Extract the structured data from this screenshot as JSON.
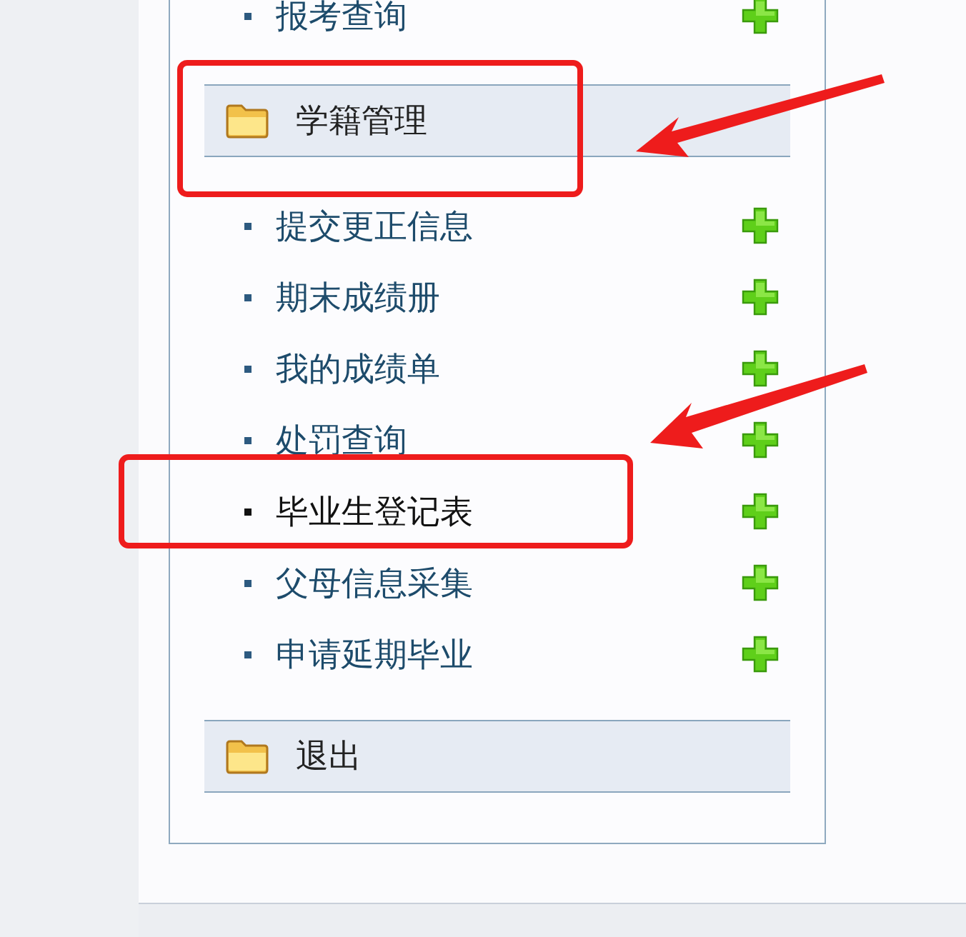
{
  "menu": [
    {
      "kind": "item",
      "label": "报考查询",
      "selected": false
    },
    {
      "kind": "header",
      "label": "学籍管理"
    },
    {
      "kind": "item",
      "label": "提交更正信息",
      "selected": false
    },
    {
      "kind": "item",
      "label": "期末成绩册",
      "selected": false
    },
    {
      "kind": "item",
      "label": "我的成绩单",
      "selected": false
    },
    {
      "kind": "item",
      "label": "处罚查询",
      "selected": false
    },
    {
      "kind": "item",
      "label": "毕业生登记表",
      "selected": true
    },
    {
      "kind": "item",
      "label": "父母信息采集",
      "selected": false
    },
    {
      "kind": "item",
      "label": "申请延期毕业",
      "selected": false
    },
    {
      "kind": "header",
      "label": "退出"
    }
  ]
}
